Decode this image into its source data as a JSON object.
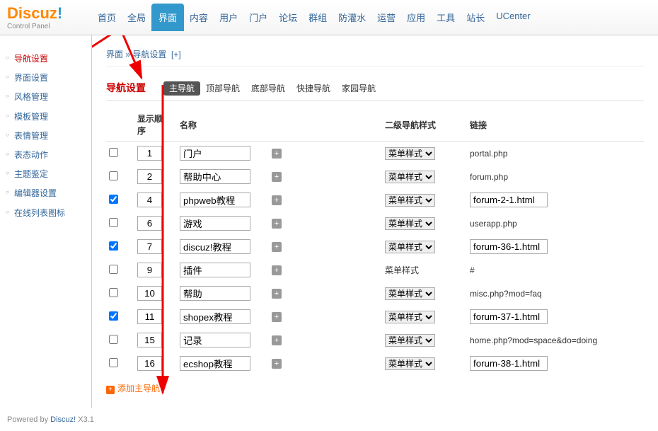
{
  "logo": {
    "main": "Discuz",
    "excl": "!",
    "sub": "Control Panel"
  },
  "topnav": [
    {
      "label": "首页"
    },
    {
      "label": "全局"
    },
    {
      "label": "界面",
      "active": true
    },
    {
      "label": "内容"
    },
    {
      "label": "用户"
    },
    {
      "label": "门户"
    },
    {
      "label": "论坛"
    },
    {
      "label": "群组"
    },
    {
      "label": "防灌水"
    },
    {
      "label": "运营"
    },
    {
      "label": "应用"
    },
    {
      "label": "工具"
    },
    {
      "label": "站长"
    },
    {
      "label": "UCenter"
    }
  ],
  "sidebar": [
    {
      "label": "导航设置",
      "active": true
    },
    {
      "label": "界面设置"
    },
    {
      "label": "风格管理"
    },
    {
      "label": "模板管理"
    },
    {
      "label": "表情管理"
    },
    {
      "label": "表态动作"
    },
    {
      "label": "主题鉴定"
    },
    {
      "label": "编辑器设置"
    },
    {
      "label": "在线列表图标"
    }
  ],
  "breadcrumb": {
    "p1": "界面",
    "sep": " » ",
    "p2": "导航设置",
    "plus": "[+]"
  },
  "subnav": {
    "title": "导航设置",
    "tabs": [
      {
        "label": "主导航",
        "active": true
      },
      {
        "label": "顶部导航"
      },
      {
        "label": "底部导航"
      },
      {
        "label": "快捷导航"
      },
      {
        "label": "家园导航"
      }
    ]
  },
  "table": {
    "headers": {
      "order": "显示顺序",
      "name": "名称",
      "style": "二级导航样式",
      "link": "链接"
    },
    "style_option": "菜单样式",
    "rows": [
      {
        "chk": false,
        "order": "1",
        "name": "门户",
        "style": "select",
        "link_text": "portal.php"
      },
      {
        "chk": false,
        "order": "2",
        "name": "帮助中心",
        "style": "select",
        "link_text": "forum.php"
      },
      {
        "chk": true,
        "order": "4",
        "name": "phpweb教程",
        "style": "select",
        "link_input": "forum-2-1.html"
      },
      {
        "chk": false,
        "order": "6",
        "name": "游戏",
        "style": "select",
        "link_text": "userapp.php"
      },
      {
        "chk": true,
        "order": "7",
        "name": "discuz!教程",
        "style": "select",
        "link_input": "forum-36-1.html"
      },
      {
        "chk": false,
        "order": "9",
        "name": "插件",
        "style": "text",
        "link_text": "#"
      },
      {
        "chk": false,
        "order": "10",
        "name": "帮助",
        "style": "select",
        "link_text": "misc.php?mod=faq"
      },
      {
        "chk": true,
        "order": "11",
        "name": "shopex教程",
        "style": "select",
        "link_input": "forum-37-1.html"
      },
      {
        "chk": false,
        "order": "15",
        "name": "记录",
        "style": "select",
        "link_text": "home.php?mod=space&do=doing"
      },
      {
        "chk": false,
        "order": "16",
        "name": "ecshop教程",
        "style": "select",
        "link_input": "forum-38-1.html"
      }
    ],
    "add_label": "添加主导航"
  },
  "footer": {
    "prefix": "Powered by ",
    "brand": "Discuz!",
    "version": " X3.1"
  }
}
